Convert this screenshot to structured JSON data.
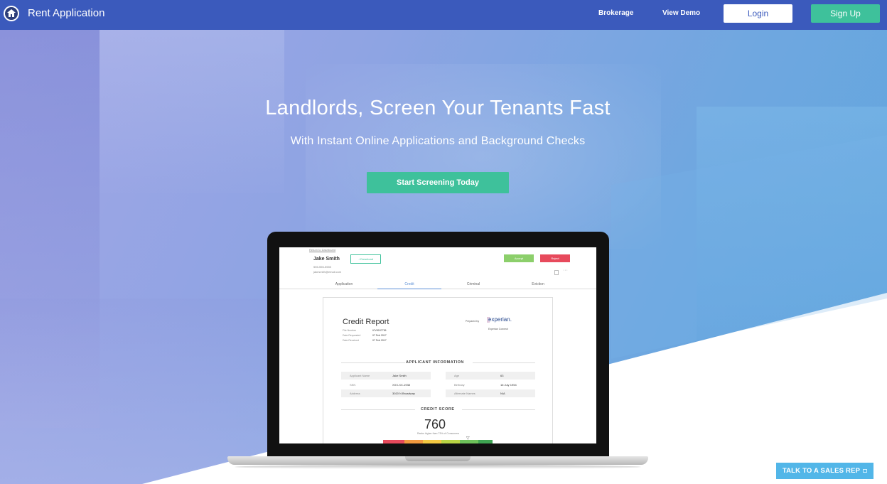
{
  "nav": {
    "brand": "Rent Application",
    "links": [
      "Brokerage",
      "View Demo"
    ],
    "login": "Login",
    "signup": "Sign Up"
  },
  "hero": {
    "title": "Landlords, Screen Your Tenants Fast",
    "subtitle": "With Instant Online Applications and Background Checks",
    "cta": "Start Screening Today"
  },
  "screen": {
    "back_link": "Return to Dashboard",
    "applicant_name": "Jake Smith",
    "phone": "555-555-5555",
    "email": "jakesmith@email.com",
    "download": "↓ Download",
    "accept": "Accept",
    "reject": "Reject",
    "tabs": [
      "Application",
      "Credit",
      "Criminal",
      "Eviction"
    ],
    "active_tab": "Credit",
    "report": {
      "title": "Credit Report",
      "meta": [
        {
          "label": "File Number",
          "value": "ICV5247736"
        },
        {
          "label": "Date Requested",
          "value": "07 Feb 2017"
        },
        {
          "label": "Date Received",
          "value": "07 Feb 2017"
        }
      ],
      "prepared_by": "Prepared by",
      "provider": "experian.",
      "provider_sub": "Experian Connect",
      "section_applicant": "APPLICANT INFORMATION",
      "fields_left": [
        {
          "label": "Applicant Name",
          "value": "Jake Smith"
        },
        {
          "label": "SSN",
          "value": "XXX-XX-1938"
        },
        {
          "label": "Address",
          "value": "3020 N Broadway"
        }
      ],
      "fields_right": [
        {
          "label": "Age",
          "value": "63"
        },
        {
          "label": "Birthday",
          "value": "16 July 1954"
        },
        {
          "label": "Alternate Names",
          "value": "N/A"
        }
      ],
      "section_score": "CREDIT SCORE",
      "score": "760",
      "score_note": "Ranks higher than 73% of Consumers"
    }
  },
  "sales_button": "TALK TO A SALES REP",
  "colors": {
    "nav_bg": "#3b5abc",
    "accent_green": "#3ec19b",
    "sales_blue": "#52b6e8",
    "accept_green": "#8ccf6b",
    "reject_red": "#e74a5c"
  }
}
